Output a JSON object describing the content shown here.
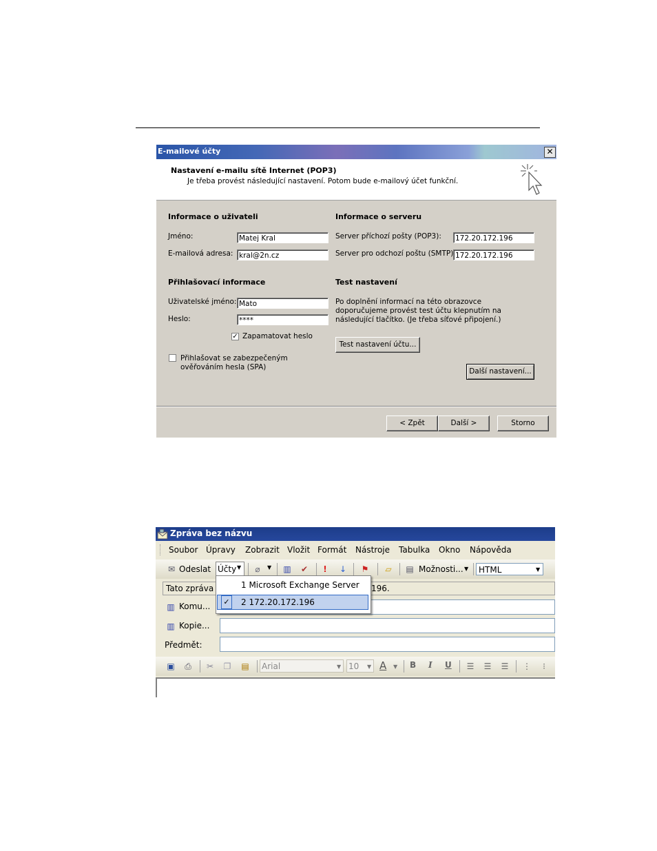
{
  "dialog": {
    "title": "E-mailové účty",
    "close_glyph": "✕",
    "header_title": "Nastavení e-mailu sítě Internet (POP3)",
    "header_subtitle": "Je třeba provést následující nastavení. Potom bude e-mailový účet funkční.",
    "user_section": "Informace o uživateli",
    "name_label": "Jméno:",
    "name_value": "Matej Kral",
    "email_label": "E-mailová adresa:",
    "email_value": "kral@2n.cz",
    "server_section": "Informace o serveru",
    "pop3_label": "Server příchozí pošty (POP3):",
    "pop3_value": "172.20.172.196",
    "smtp_label": "Server pro odchozí poštu (SMTP):",
    "smtp_value": "172.20.172.196",
    "login_section": "Přihlašovací informace",
    "username_label": "Uživatelské jméno:",
    "username_value": "Mato",
    "password_label": "Heslo:",
    "password_value": "****",
    "remember_label": "Zapamatovat heslo",
    "remember_checked": true,
    "spa_label_1": "Přihlašovat se zabezpečeným",
    "spa_label_2": "ověřováním hesla (SPA)",
    "spa_checked": false,
    "test_section": "Test nastavení",
    "test_text_1": "Po doplnění informací na této obrazovce",
    "test_text_2": "doporučujeme provést test účtu klepnutím na",
    "test_text_3": "následující tlačítko. (Je třeba síťové připojení.)",
    "test_button": "Test nastavení účtu...",
    "more_button": "Další nastavení...",
    "back_button": "< Zpět",
    "next_button": "Další >",
    "cancel_button": "Storno"
  },
  "message_window": {
    "title": "Zpráva bez názvu",
    "menu": [
      "Soubor",
      "Úpravy",
      "Zobrazit",
      "Vložit",
      "Formát",
      "Nástroje",
      "Tabulka",
      "Okno",
      "Nápověda"
    ],
    "send_button": "Odeslat",
    "accounts_button": "Účty",
    "options_button": "Možnosti...",
    "format_value": "HTML",
    "info_bar_left": "Tato zpráva b",
    "info_bar_right": "196.",
    "to_label": "Komu...",
    "cc_label": "Kopie...",
    "subject_label": "Předmět:",
    "font_value": "Arial",
    "size_value": "10",
    "bold": "B",
    "italic": "I",
    "underline": "U",
    "font_color": "A",
    "accounts_menu": [
      {
        "label": "1 Microsoft Exchange Server",
        "checked": false
      },
      {
        "label": "2 172.20.172.196",
        "checked": true
      }
    ],
    "check_glyph": "✓"
  }
}
